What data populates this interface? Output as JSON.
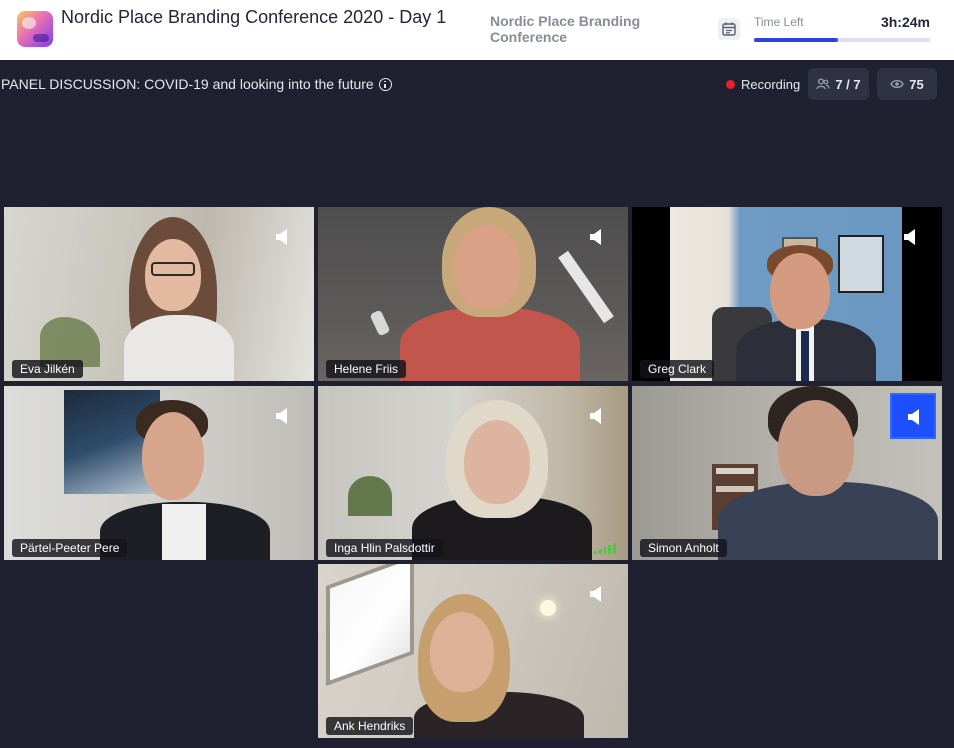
{
  "header": {
    "event_title": "Nordic Place Branding Conference 2020 - Day 1",
    "organizer": "Nordic Place Branding Conference",
    "time_left_label": "Time Left",
    "time_left_value": "3h:24m",
    "time_progress_fraction": 0.48,
    "accent_color": "#2b44e0"
  },
  "session": {
    "title": "PANEL DISCUSSION: COVID-19 and looking into the future",
    "recording_label": "Recording",
    "participants_count": "7 / 7",
    "viewers_count": "75",
    "recording_color": "#e8212e"
  },
  "participants": [
    {
      "name": "Eva Jilkén",
      "speaking": false
    },
    {
      "name": "Helene Friis",
      "speaking": false
    },
    {
      "name": "Greg Clark",
      "speaking": false
    },
    {
      "name": "Pärtel-Peeter Pere",
      "speaking": false
    },
    {
      "name": "Inga Hlin Palsdottir",
      "speaking": false,
      "signal_icon": "signal-bars-icon"
    },
    {
      "name": "Simon Anholt",
      "speaking": true
    },
    {
      "name": "Ank Hendriks",
      "speaking": false
    }
  ]
}
